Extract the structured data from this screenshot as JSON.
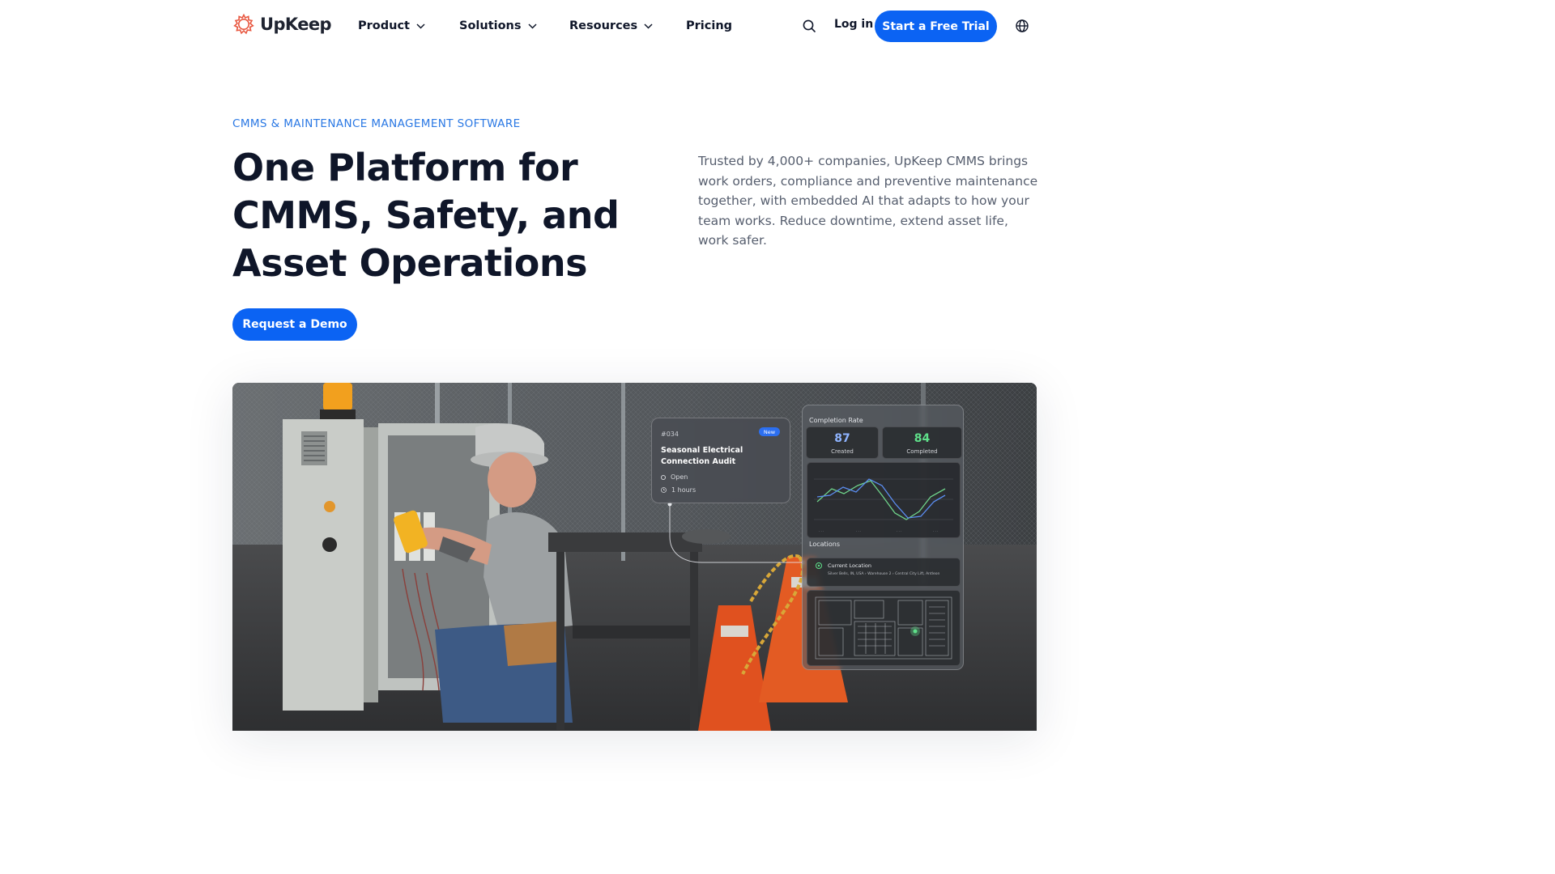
{
  "nav": {
    "logo": "UpKeep",
    "items": [
      {
        "label": "Product",
        "has_dropdown": true
      },
      {
        "label": "Solutions",
        "has_dropdown": true
      },
      {
        "label": "Resources",
        "has_dropdown": true
      },
      {
        "label": "Pricing",
        "has_dropdown": false
      }
    ],
    "search_icon": "search-icon",
    "login": "Log in",
    "cta": "Start a Free Trial",
    "language_icon": "globe-icon"
  },
  "hero": {
    "eyebrow": "CMMS & MAINTENANCE MANAGEMENT SOFTWARE",
    "headline_lines": [
      "One Platform for",
      "CMMS, Safety, and",
      "Asset Operations"
    ],
    "description": "Trusted by 4,000+ companies, UpKeep CMMS brings work orders, compliance and preventive maintenance together, with embedded AI that adapts to how your team works. Reduce downtime, extend asset life, work safer.",
    "cta": "Request a Demo"
  },
  "overlay": {
    "work_order": {
      "id": "#034",
      "badge": "New",
      "title": "Seasonal Electrical Connection Audit",
      "status": "Open",
      "duration": "1 hours"
    },
    "stats": {
      "title": "Completion Rate",
      "created": {
        "value": "87",
        "label": "Created"
      },
      "completed": {
        "value": "84",
        "label": "Completed"
      }
    },
    "locations": {
      "title": "Locations",
      "current_label": "Current Location",
      "path": "Silver Bells, IN, USA  ›  Warehouse 2  ›  Central City Lift, Antleon"
    }
  },
  "colors": {
    "brand_blue": "#0b63f3",
    "eyebrow_blue": "#2a78e4",
    "logo_red": "#e8563f",
    "created_blue": "#8fb4ff",
    "completed_green": "#5fe08a"
  }
}
